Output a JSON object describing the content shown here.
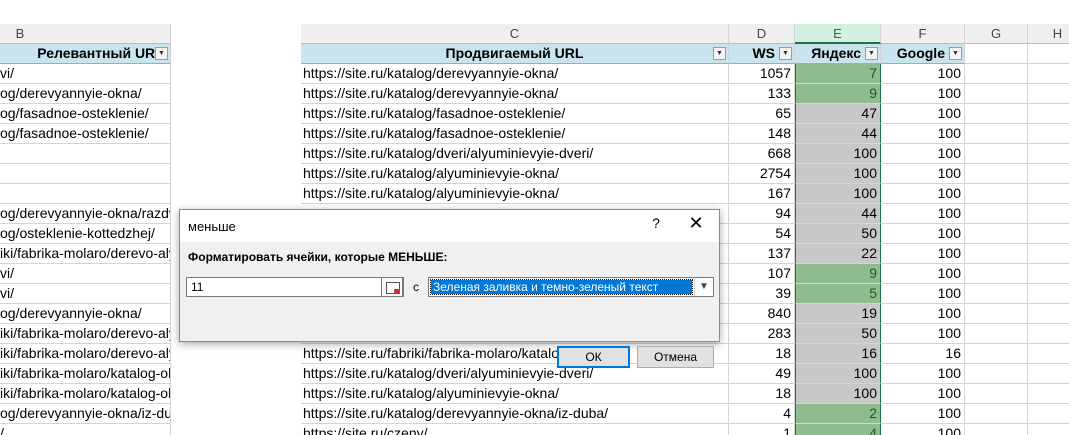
{
  "columns": [
    {
      "letter": "B",
      "key": "b"
    },
    {
      "letter": "C",
      "key": "c"
    },
    {
      "letter": "D",
      "key": "d"
    },
    {
      "letter": "E",
      "key": "e",
      "selected": true
    },
    {
      "letter": "F",
      "key": "f"
    },
    {
      "letter": "G",
      "key": "g"
    },
    {
      "letter": "H",
      "key": "h"
    }
  ],
  "header": {
    "b": "Релевантный URL",
    "c": "Продвигаемый URL",
    "d": "WS",
    "e": "Яндекс",
    "f": "Google"
  },
  "rows": [
    {
      "b": "vi/",
      "c": "https://site.ru/katalog/derevyannyie-okna/",
      "d": "1057",
      "e": "7",
      "e_fmt": "green",
      "f": "100"
    },
    {
      "b": "og/derevyannyie-okna/",
      "c": "https://site.ru/katalog/derevyannyie-okna/",
      "d": "133",
      "e": "9",
      "e_fmt": "green",
      "f": "100"
    },
    {
      "b": "og/fasadnoe-osteklenie/",
      "c": "https://site.ru/katalog/fasadnoe-osteklenie/",
      "d": "65",
      "e": "47",
      "e_fmt": "grey",
      "f": "100"
    },
    {
      "b": "og/fasadnoe-osteklenie/",
      "c": "https://site.ru/katalog/fasadnoe-osteklenie/",
      "d": "148",
      "e": "44",
      "e_fmt": "grey",
      "f": "100"
    },
    {
      "b": "",
      "c": "https://site.ru/katalog/dveri/alyuminievyie-dveri/",
      "d": "668",
      "e": "100",
      "e_fmt": "grey",
      "f": "100"
    },
    {
      "b": "",
      "c": "https://site.ru/katalog/alyuminievyie-okna/",
      "d": "2754",
      "e": "100",
      "e_fmt": "grey",
      "f": "100"
    },
    {
      "b": "",
      "c": "https://site.ru/katalog/alyuminievyie-okna/",
      "d": "167",
      "e": "100",
      "e_fmt": "grey",
      "f": "100"
    },
    {
      "b": "og/derevyannyie-okna/razdvizhnyie-okna/",
      "c": "",
      "d": "94",
      "e": "44",
      "e_fmt": "grey",
      "f": "100"
    },
    {
      "b": "og/osteklenie-kottedzhej/",
      "c": "",
      "d": "54",
      "e": "50",
      "e_fmt": "grey",
      "f": "100"
    },
    {
      "b": "iki/fabrika-molaro/derevo-alyuminievyie-okna/",
      "c": "",
      "d": "137",
      "e": "22",
      "e_fmt": "grey",
      "f": "100"
    },
    {
      "b": "vi/",
      "c": "",
      "d": "107",
      "e": "9",
      "e_fmt": "green",
      "f": "100"
    },
    {
      "b": "vi/",
      "c": "",
      "d": "39",
      "e": "5",
      "e_fmt": "green",
      "f": "100"
    },
    {
      "b": "og/derevyannyie-okna/",
      "c": "",
      "d": "840",
      "e": "19",
      "e_fmt": "grey",
      "f": "100"
    },
    {
      "b": "iki/fabrika-molaro/derevo-alyuminievyie-okna/",
      "c": "",
      "d": "283",
      "e": "50",
      "e_fmt": "grey",
      "f": "100"
    },
    {
      "b": "iki/fabrika-molaro/derevo-alyuminievyie-okna/",
      "c": "https://site.ru/fabriki/fabrika-molaro/katalog-okna/",
      "d": "18",
      "e": "16",
      "e_fmt": "grey",
      "f": "16"
    },
    {
      "b": "iki/fabrika-molaro/katalog-okna/",
      "c": "https://site.ru/katalog/dveri/alyuminievyie-dveri/",
      "d": "49",
      "e": "100",
      "e_fmt": "grey",
      "f": "100"
    },
    {
      "b": "iki/fabrika-molaro/katalog-okna/",
      "c": "https://site.ru/katalog/alyuminievyie-okna/",
      "d": "18",
      "e": "100",
      "e_fmt": "grey",
      "f": "100"
    },
    {
      "b": "og/derevyannyie-okna/iz-duba/",
      "c": "https://site.ru/katalog/derevyannyie-okna/iz-duba/",
      "d": "4",
      "e": "2",
      "e_fmt": "green",
      "f": "100"
    },
    {
      "b": "/",
      "c": "https://site.ru/czeny/",
      "d": "1",
      "e": "4",
      "e_fmt": "green",
      "f": "100"
    }
  ],
  "dialog": {
    "title": "меньше",
    "help": "?",
    "close": "✕",
    "label": "Форматировать ячейки, которые МЕНЬШЕ:",
    "value": "11",
    "connector": "с",
    "format_option": "Зеленая заливка и темно-зеленый текст",
    "ok": "ОК",
    "cancel": "Отмена"
  },
  "colors": {
    "green_fill": "#8fbc8f",
    "green_text": "#1e5c1e",
    "grey_fill": "#c8c8c8",
    "header_fill": "#c9e4ee",
    "accent": "#0078d7"
  }
}
